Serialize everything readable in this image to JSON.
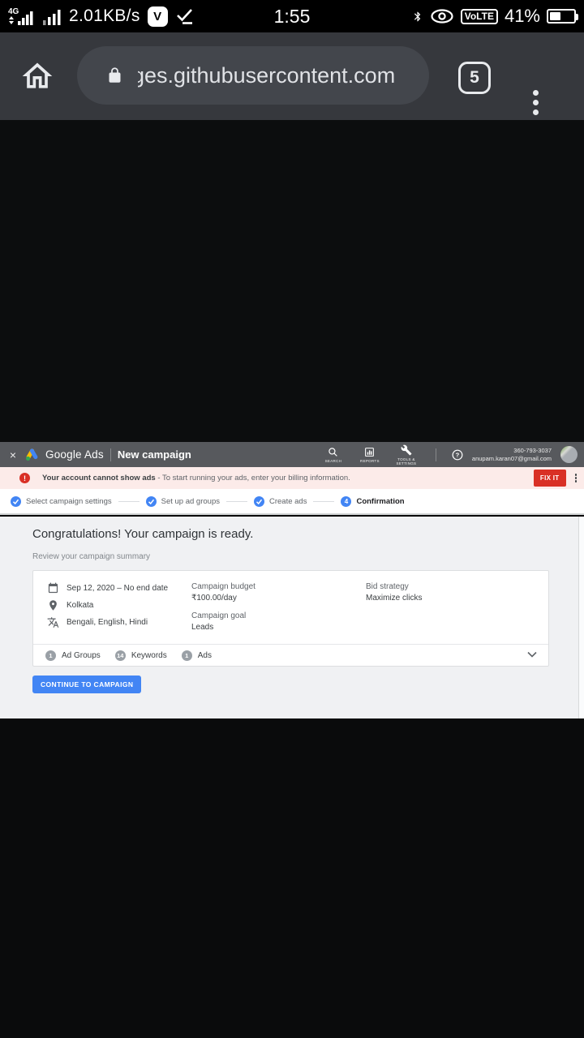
{
  "status_bar": {
    "network_type": "4G",
    "speed": "2.01KB/s",
    "v_badge": "V",
    "time": "1:55",
    "volte_label": "VoLTE",
    "battery_percent": "41%"
  },
  "browser": {
    "url_clipped_char": "g",
    "url": "es.githubusercontent.com",
    "tab_count": "5"
  },
  "ads_header": {
    "close_label": "×",
    "brand": "Google Ads",
    "page_title": "New campaign",
    "nav": [
      {
        "label": "SEARCH"
      },
      {
        "label": "REPORTS"
      },
      {
        "label": "TOOLS & SETTINGS"
      }
    ],
    "help_label": "?",
    "phone": "360-793-3037",
    "email": "anupam.karan07@gmail.com"
  },
  "alert": {
    "icon_label": "!",
    "title": "Your account cannot show ads",
    "message": " - To start running your ads, enter your billing information.",
    "action_label": "FIX IT"
  },
  "stepper": {
    "steps": [
      {
        "label": "Select campaign settings"
      },
      {
        "label": "Set up ad groups"
      },
      {
        "label": "Create ads"
      },
      {
        "label": "Confirmation",
        "number": "4"
      }
    ]
  },
  "main": {
    "heading": "Congratulations! Your campaign is ready.",
    "subheading": "Review your campaign summary",
    "summary": {
      "date_range": "Sep 12, 2020 – No end date",
      "location": "Kolkata",
      "languages": "Bengali, English, Hindi",
      "budget_label": "Campaign budget",
      "budget_value": "₹100.00/day",
      "goal_label": "Campaign goal",
      "goal_value": "Leads",
      "bid_label": "Bid strategy",
      "bid_value": "Maximize clicks"
    },
    "counts": [
      {
        "value": "1",
        "label": "Ad Groups"
      },
      {
        "value": "14",
        "label": "Keywords"
      },
      {
        "value": "1",
        "label": "Ads"
      }
    ],
    "continue_label": "CONTINUE TO CAMPAIGN"
  },
  "colors": {
    "accent_blue": "#4285f4",
    "alert_red": "#d93025",
    "alert_bg": "#fcebe9",
    "header_gray": "#57595d",
    "content_bg": "#f0f1f3"
  }
}
